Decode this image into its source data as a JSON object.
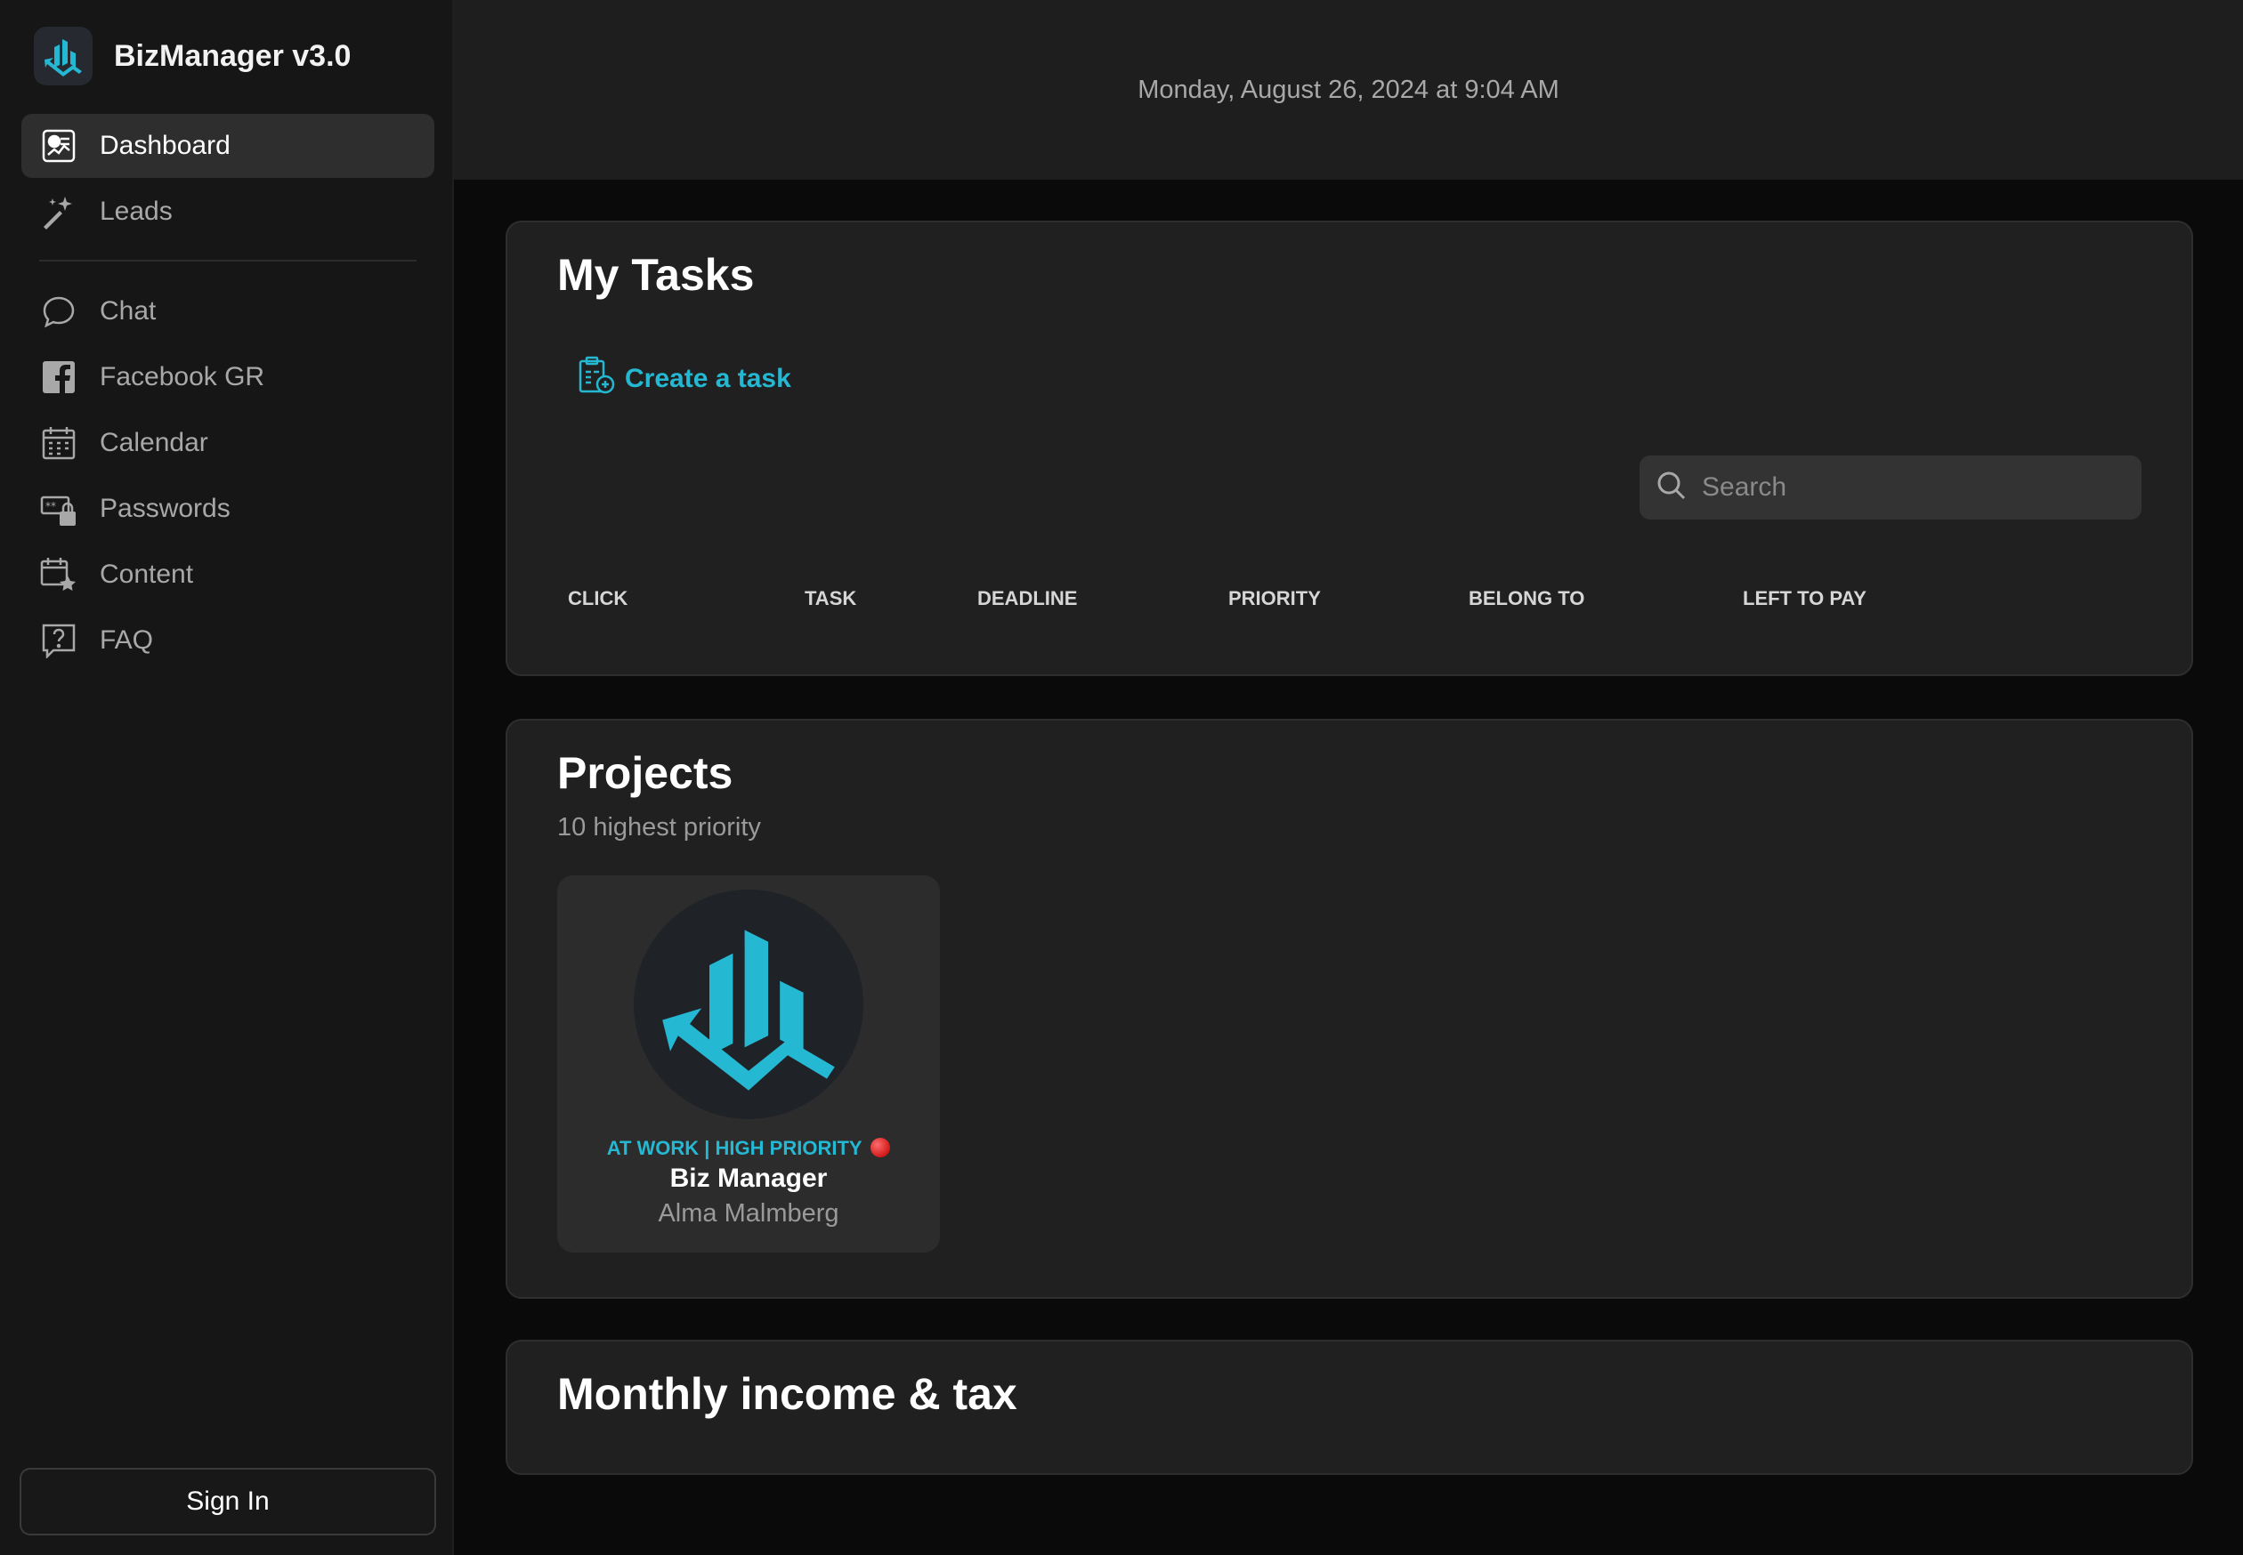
{
  "brand": {
    "title": "BizManager v3.0",
    "accent": "#25b8d3"
  },
  "sidebar": {
    "items": [
      {
        "label": "Dashboard",
        "icon": "dashboard-icon",
        "active": true
      },
      {
        "label": "Leads",
        "icon": "magic-wand-icon"
      },
      {
        "label": "Chat",
        "icon": "chat-bubble-icon"
      },
      {
        "label": "Facebook GR",
        "icon": "facebook-icon"
      },
      {
        "label": "Calendar",
        "icon": "calendar-icon"
      },
      {
        "label": "Passwords",
        "icon": "password-lock-icon"
      },
      {
        "label": "Content",
        "icon": "calendar-star-icon"
      },
      {
        "label": "FAQ",
        "icon": "question-bubble-icon"
      }
    ],
    "signin_label": "Sign In"
  },
  "header": {
    "datetime": "Monday, August 26, 2024 at 9:04 AM"
  },
  "tasks": {
    "title": "My Tasks",
    "create_label": "Create a task",
    "search_placeholder": "Search",
    "columns": [
      "CLICK",
      "TASK",
      "DEADLINE",
      "PRIORITY",
      "BELONG TO",
      "LEFT TO PAY"
    ]
  },
  "projects": {
    "title": "Projects",
    "subtitle": "10 highest priority",
    "items": [
      {
        "status": "AT WORK | HIGH PRIORITY",
        "name": "Biz Manager",
        "owner": "Alma Malmberg",
        "priority_color": "#d11a1a"
      }
    ]
  },
  "income": {
    "title": "Monthly income & tax"
  }
}
